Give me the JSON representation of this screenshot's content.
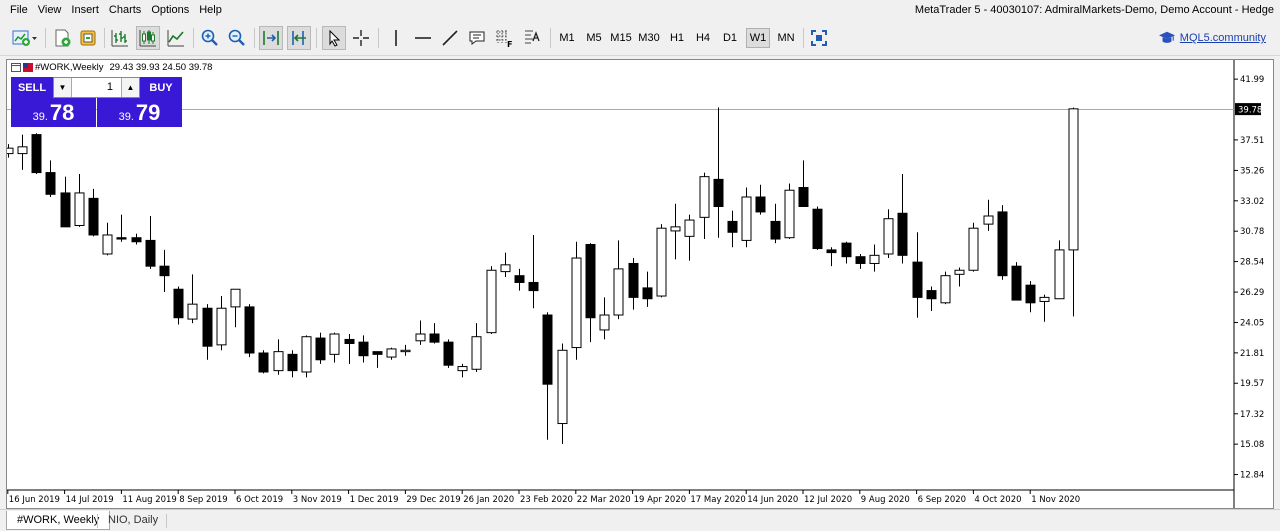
{
  "menu": [
    "File",
    "View",
    "Insert",
    "Charts",
    "Options",
    "Help"
  ],
  "app_title": "MetaTrader 5 - 40030107: AdmiralMarkets-Demo, Demo Account - Hedge",
  "toolbar": {
    "timeframes": [
      "M1",
      "M5",
      "M15",
      "M30",
      "H1",
      "H4",
      "D1",
      "W1",
      "MN"
    ],
    "active_timeframe": "W1",
    "community_link": "MQL5.community"
  },
  "chart_info": {
    "symbol_label": "#WORK,Weekly",
    "ohlc": "29.43 39.93 24.50 39.78"
  },
  "trade_panel": {
    "sell_label": "SELL",
    "buy_label": "BUY",
    "lot": "1",
    "sell_price_small": "39.",
    "sell_price_big": "78",
    "buy_price_small": "39.",
    "buy_price_big": "79"
  },
  "tabs": [
    {
      "label": "#WORK, Weekly",
      "active": true
    },
    {
      "label": "NIO, Daily",
      "active": false
    }
  ],
  "colors": {
    "panel_blue": "#3a19d6",
    "bullish_candle": "#ffffff",
    "bearish_candle": "#000000",
    "link_blue": "#1a3fb0"
  },
  "chart_data": {
    "type": "candlestick",
    "symbol": "#WORK",
    "timeframe": "Weekly",
    "ylim": [
      11.7,
      43.4
    ],
    "y_ticks": [
      "41.99",
      "39.78",
      "37.51",
      "35.26",
      "33.02",
      "30.78",
      "28.54",
      "26.29",
      "24.05",
      "21.81",
      "19.57",
      "17.32",
      "15.08",
      "12.84"
    ],
    "current_price": 39.78,
    "current_price_label": "39.78",
    "x_labels": [
      "16 Jun 2019",
      "14 Jul 2019",
      "11 Aug 2019",
      "8 Sep 2019",
      "6 Oct 2019",
      "3 Nov 2019",
      "1 Dec 2019",
      "29 Dec 2019",
      "26 Jan 2020",
      "23 Feb 2020",
      "22 Mar 2020",
      "19 Apr 2020",
      "17 May 2020",
      "14 Jun 2020",
      "12 Jul 2020",
      "9 Aug 2020",
      "6 Sep 2020",
      "4 Oct 2020",
      "1 Nov 2020"
    ],
    "candles": [
      {
        "o": 36.5,
        "h": 37.2,
        "l": 36.2,
        "c": 36.9
      },
      {
        "o": 36.5,
        "h": 37.9,
        "l": 35.3,
        "c": 37.0
      },
      {
        "o": 37.9,
        "h": 38.0,
        "l": 35.0,
        "c": 35.1
      },
      {
        "o": 35.1,
        "h": 36.0,
        "l": 33.3,
        "c": 33.5
      },
      {
        "o": 33.6,
        "h": 34.8,
        "l": 31.1,
        "c": 31.1
      },
      {
        "o": 31.2,
        "h": 35.0,
        "l": 31.1,
        "c": 33.6
      },
      {
        "o": 33.2,
        "h": 33.9,
        "l": 30.4,
        "c": 30.5
      },
      {
        "o": 29.1,
        "h": 31.4,
        "l": 29.0,
        "c": 30.5
      },
      {
        "o": 30.3,
        "h": 32.0,
        "l": 30.0,
        "c": 30.2
      },
      {
        "o": 30.3,
        "h": 30.6,
        "l": 29.8,
        "c": 30.0
      },
      {
        "o": 30.1,
        "h": 31.9,
        "l": 28.0,
        "c": 28.2
      },
      {
        "o": 28.2,
        "h": 29.4,
        "l": 26.3,
        "c": 27.5
      },
      {
        "o": 26.5,
        "h": 26.7,
        "l": 23.9,
        "c": 24.4
      },
      {
        "o": 24.3,
        "h": 27.6,
        "l": 24.0,
        "c": 25.4
      },
      {
        "o": 25.1,
        "h": 25.4,
        "l": 21.3,
        "c": 22.3
      },
      {
        "o": 22.4,
        "h": 26.0,
        "l": 22.0,
        "c": 25.1
      },
      {
        "o": 25.2,
        "h": 26.3,
        "l": 23.7,
        "c": 26.5
      },
      {
        "o": 25.2,
        "h": 25.4,
        "l": 21.5,
        "c": 21.8
      },
      {
        "o": 21.8,
        "h": 22.0,
        "l": 20.3,
        "c": 20.4
      },
      {
        "o": 20.5,
        "h": 22.8,
        "l": 20.2,
        "c": 21.9
      },
      {
        "o": 21.7,
        "h": 22.0,
        "l": 20.0,
        "c": 20.5
      },
      {
        "o": 20.4,
        "h": 23.1,
        "l": 20.0,
        "c": 23.0
      },
      {
        "o": 22.9,
        "h": 23.3,
        "l": 21.0,
        "c": 21.3
      },
      {
        "o": 21.7,
        "h": 23.3,
        "l": 21.1,
        "c": 23.2
      },
      {
        "o": 22.8,
        "h": 23.2,
        "l": 21.0,
        "c": 22.5
      },
      {
        "o": 22.6,
        "h": 23.1,
        "l": 21.1,
        "c": 21.6
      },
      {
        "o": 21.9,
        "h": 21.9,
        "l": 20.7,
        "c": 21.7
      },
      {
        "o": 21.5,
        "h": 22.2,
        "l": 21.3,
        "c": 22.1
      },
      {
        "o": 21.9,
        "h": 22.4,
        "l": 21.6,
        "c": 22.0
      },
      {
        "o": 22.7,
        "h": 24.2,
        "l": 22.4,
        "c": 23.2
      },
      {
        "o": 23.2,
        "h": 24.0,
        "l": 22.5,
        "c": 22.6
      },
      {
        "o": 22.6,
        "h": 22.8,
        "l": 20.7,
        "c": 20.9
      },
      {
        "o": 20.5,
        "h": 21.0,
        "l": 20.0,
        "c": 20.8
      },
      {
        "o": 20.6,
        "h": 24.0,
        "l": 20.4,
        "c": 23.0
      },
      {
        "o": 23.3,
        "h": 28.2,
        "l": 23.2,
        "c": 27.9
      },
      {
        "o": 27.8,
        "h": 29.2,
        "l": 27.4,
        "c": 28.3
      },
      {
        "o": 27.5,
        "h": 28.0,
        "l": 26.4,
        "c": 27.0
      },
      {
        "o": 27.0,
        "h": 30.5,
        "l": 25.1,
        "c": 26.4
      },
      {
        "o": 24.6,
        "h": 24.8,
        "l": 15.4,
        "c": 19.5
      },
      {
        "o": 16.6,
        "h": 22.5,
        "l": 15.1,
        "c": 22.0
      },
      {
        "o": 22.2,
        "h": 30.0,
        "l": 21.3,
        "c": 28.8
      },
      {
        "o": 29.8,
        "h": 29.9,
        "l": 22.6,
        "c": 24.4
      },
      {
        "o": 23.5,
        "h": 25.9,
        "l": 22.8,
        "c": 24.6
      },
      {
        "o": 24.6,
        "h": 30.1,
        "l": 24.3,
        "c": 28.0
      },
      {
        "o": 28.4,
        "h": 28.8,
        "l": 25.0,
        "c": 25.9
      },
      {
        "o": 26.6,
        "h": 27.8,
        "l": 25.2,
        "c": 25.8
      },
      {
        "o": 26.0,
        "h": 31.3,
        "l": 25.9,
        "c": 31.0
      },
      {
        "o": 30.8,
        "h": 32.8,
        "l": 28.7,
        "c": 31.1
      },
      {
        "o": 30.4,
        "h": 32.0,
        "l": 28.6,
        "c": 31.6
      },
      {
        "o": 31.8,
        "h": 35.1,
        "l": 30.2,
        "c": 34.8
      },
      {
        "o": 34.6,
        "h": 39.9,
        "l": 30.3,
        "c": 32.6
      },
      {
        "o": 31.5,
        "h": 32.3,
        "l": 29.6,
        "c": 30.7
      },
      {
        "o": 30.1,
        "h": 34.0,
        "l": 29.6,
        "c": 33.3
      },
      {
        "o": 33.3,
        "h": 34.2,
        "l": 32.0,
        "c": 32.2
      },
      {
        "o": 31.5,
        "h": 32.8,
        "l": 29.9,
        "c": 30.2
      },
      {
        "o": 30.3,
        "h": 34.3,
        "l": 30.2,
        "c": 33.8
      },
      {
        "o": 34.0,
        "h": 36.0,
        "l": 33.6,
        "c": 32.6
      },
      {
        "o": 32.4,
        "h": 32.6,
        "l": 29.4,
        "c": 29.5
      },
      {
        "o": 29.4,
        "h": 29.6,
        "l": 28.2,
        "c": 29.2
      },
      {
        "o": 29.9,
        "h": 30.0,
        "l": 28.4,
        "c": 28.9
      },
      {
        "o": 28.9,
        "h": 29.1,
        "l": 28.0,
        "c": 28.4
      },
      {
        "o": 28.4,
        "h": 29.8,
        "l": 27.8,
        "c": 29.0
      },
      {
        "o": 29.1,
        "h": 32.4,
        "l": 28.8,
        "c": 31.7
      },
      {
        "o": 32.1,
        "h": 35.0,
        "l": 28.4,
        "c": 29.0
      },
      {
        "o": 28.5,
        "h": 30.7,
        "l": 24.4,
        "c": 25.9
      },
      {
        "o": 26.4,
        "h": 26.7,
        "l": 24.9,
        "c": 25.8
      },
      {
        "o": 25.5,
        "h": 27.8,
        "l": 25.4,
        "c": 27.5
      },
      {
        "o": 27.6,
        "h": 28.1,
        "l": 26.7,
        "c": 27.9
      },
      {
        "o": 27.9,
        "h": 31.4,
        "l": 27.8,
        "c": 31.0
      },
      {
        "o": 31.3,
        "h": 33.1,
        "l": 30.8,
        "c": 31.9
      },
      {
        "o": 32.2,
        "h": 32.7,
        "l": 27.2,
        "c": 27.5
      },
      {
        "o": 28.2,
        "h": 28.5,
        "l": 25.7,
        "c": 25.7
      },
      {
        "o": 26.8,
        "h": 27.1,
        "l": 24.8,
        "c": 25.5
      },
      {
        "o": 25.6,
        "h": 26.1,
        "l": 24.1,
        "c": 25.9
      },
      {
        "o": 25.8,
        "h": 30.1,
        "l": 25.8,
        "c": 29.4
      },
      {
        "o": 29.4,
        "h": 39.9,
        "l": 24.5,
        "c": 39.8
      }
    ]
  }
}
